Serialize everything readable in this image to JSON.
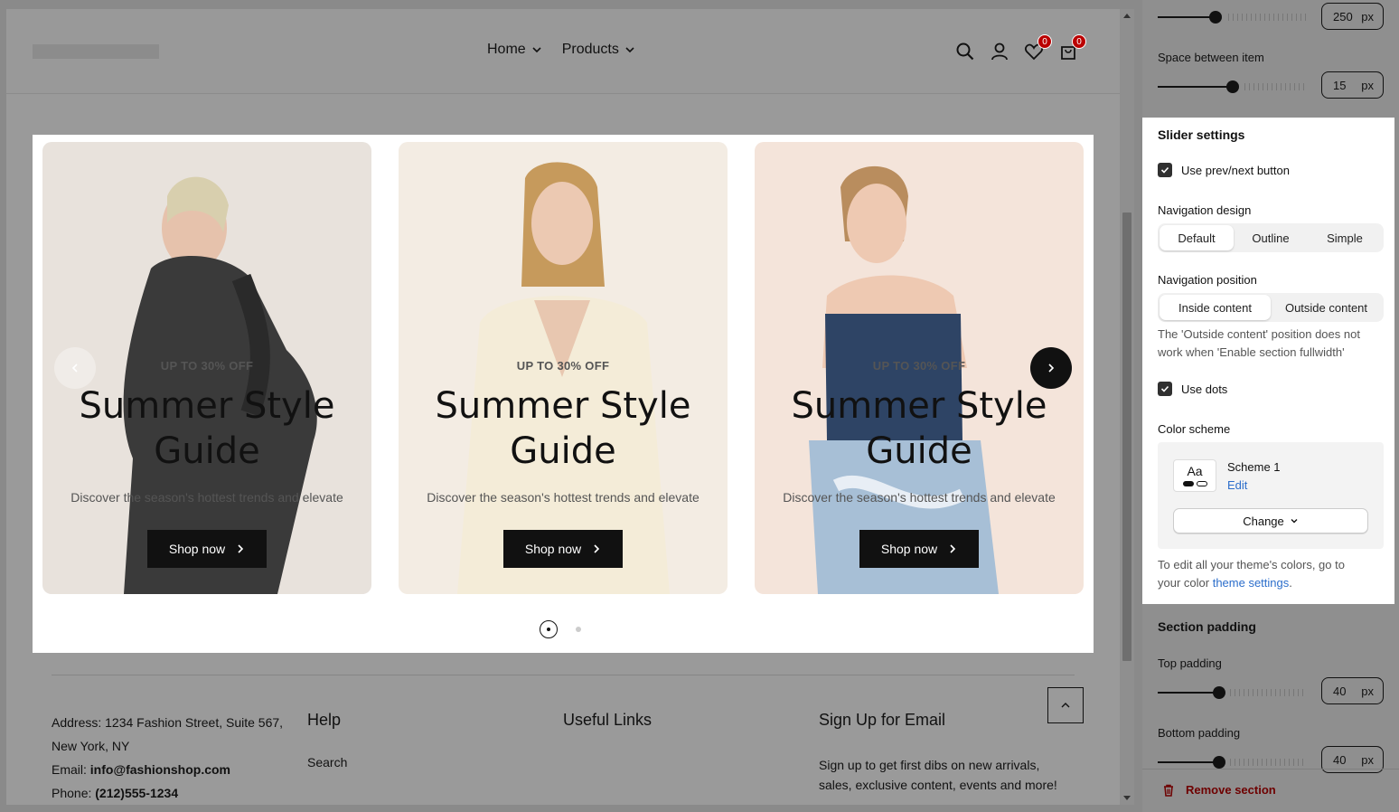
{
  "header": {
    "nav": [
      {
        "label": "Home"
      },
      {
        "label": "Products"
      }
    ],
    "wishlist_count": "0",
    "cart_count": "0"
  },
  "slider": {
    "cards": [
      {
        "eyebrow": "UP TO 30% OFF",
        "title_line1": "Summer Style",
        "title_line2": "Guide",
        "description": "Discover the season's hottest trends and elevate",
        "button": "Shop now",
        "bg": "#e8e2dc"
      },
      {
        "eyebrow": "UP TO 30% OFF",
        "title_line1": "Summer Style",
        "title_line2": "Guide",
        "description": "Discover the season's hottest trends and elevate",
        "button": "Shop now",
        "bg": "#f3ece3"
      },
      {
        "eyebrow": "UP TO 30% OFF",
        "title_line1": "Summer Style",
        "title_line2": "Guide",
        "description": "Discover the season's hottest trends and elevate",
        "button": "Shop now",
        "bg": "#f4e4da"
      }
    ]
  },
  "footer": {
    "address": "Address: 1234 Fashion Street, Suite 567,",
    "address2": "New York, NY",
    "email_label": "Email: ",
    "email": "info@fashionshop.com",
    "phone_label": "Phone: ",
    "phone": "(212)555-1234",
    "help_heading": "Help",
    "help_link": "Search",
    "links_heading": "Useful Links",
    "signup_heading": "Sign Up for Email",
    "signup_text1": "Sign up to get first dibs on new arrivals,",
    "signup_text2": "sales, exclusive content, events and more!"
  },
  "panel": {
    "top_value": "250",
    "unit": "px",
    "space_label": "Space between item",
    "space_value": "15",
    "slider_settings_heading": "Slider settings",
    "use_prev_next": "Use prev/next button",
    "nav_design_label": "Navigation design",
    "nav_design_options": [
      "Default",
      "Outline",
      "Simple"
    ],
    "nav_position_label": "Navigation position",
    "nav_position_options": [
      "Inside content",
      "Outside content"
    ],
    "nav_position_help1": "The 'Outside content' position does not",
    "nav_position_help2": "work when 'Enable section fullwidth'",
    "use_dots": "Use dots",
    "color_scheme_label": "Color scheme",
    "scheme_aa": "Aa",
    "scheme_name": "Scheme 1",
    "scheme_edit": "Edit",
    "change_label": "Change",
    "color_help1": "To edit all your theme's colors, go to",
    "color_help2_pre": "your color ",
    "color_help2_link": "theme settings",
    "color_help2_post": ".",
    "section_padding_heading": "Section padding",
    "top_padding_label": "Top padding",
    "top_padding_value": "40",
    "bottom_padding_label": "Bottom padding",
    "bottom_padding_value": "40",
    "remove_section": "Remove section"
  },
  "colors": {
    "accent_link": "#2c6ecb",
    "badge": "#bb0000",
    "danger": "#6e0000"
  }
}
